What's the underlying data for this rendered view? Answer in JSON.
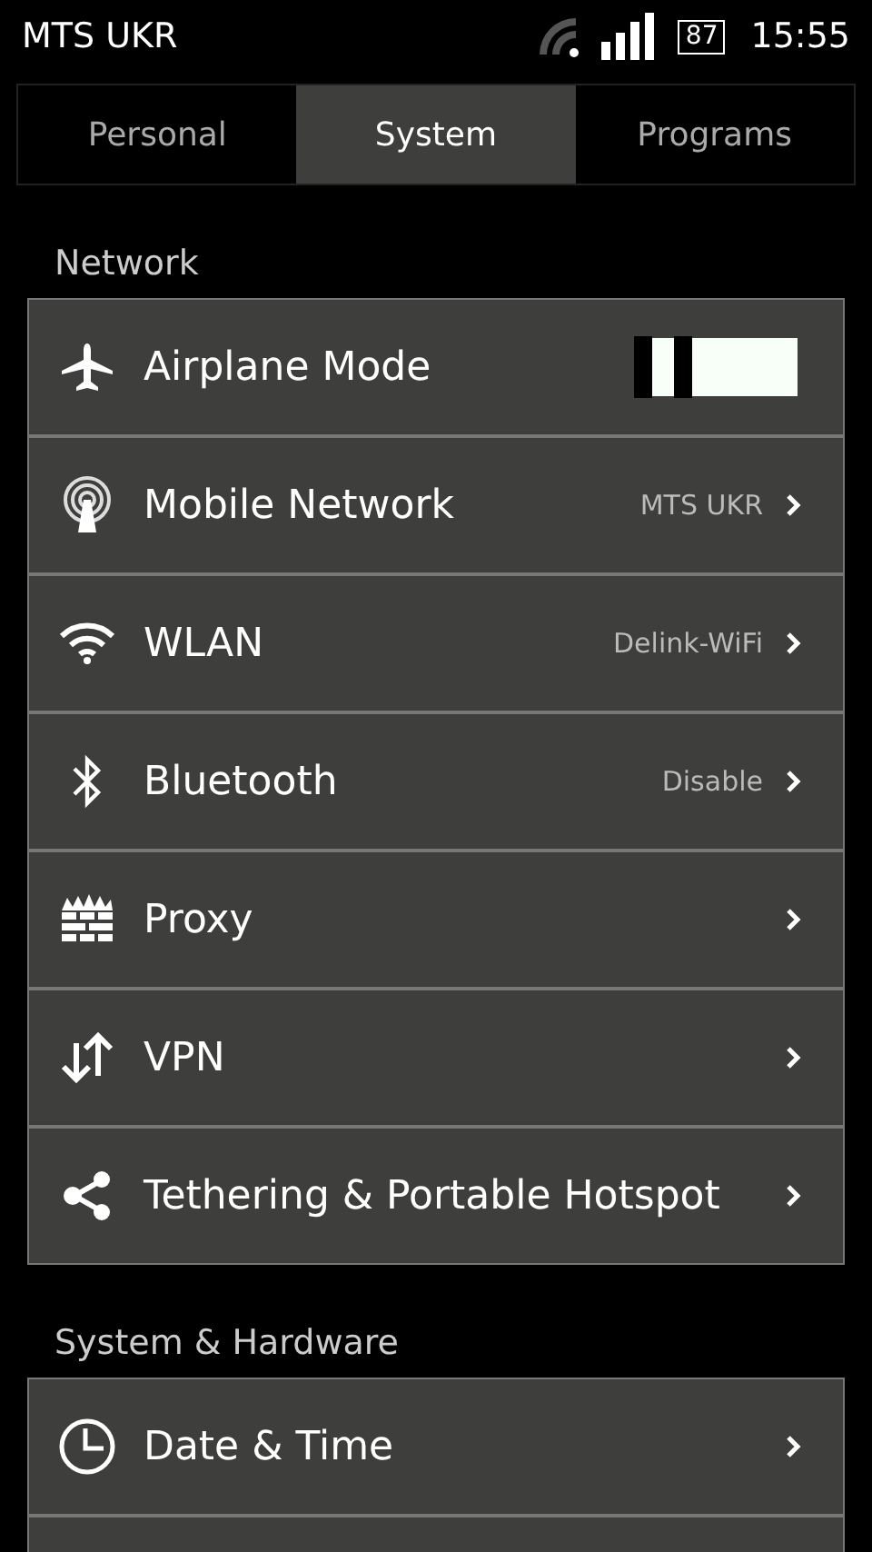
{
  "status_bar": {
    "carrier": "MTS UKR",
    "battery": "87",
    "time": "15:55"
  },
  "tabs": [
    {
      "label": "Personal",
      "selected": false
    },
    {
      "label": "System",
      "selected": true
    },
    {
      "label": "Programs",
      "selected": false
    }
  ],
  "sections": [
    {
      "title": "Network",
      "items": [
        {
          "label": "Airplane Mode",
          "kind": "toggle",
          "on": false
        },
        {
          "label": "Mobile Network",
          "kind": "link",
          "value": "MTS UKR"
        },
        {
          "label": "WLAN",
          "kind": "link",
          "value": "Delink-WiFi"
        },
        {
          "label": "Bluetooth",
          "kind": "link",
          "value": "Disable"
        },
        {
          "label": "Proxy",
          "kind": "link"
        },
        {
          "label": "VPN",
          "kind": "link"
        },
        {
          "label": "Tethering & Portable Hotspot",
          "kind": "link"
        }
      ]
    },
    {
      "title": "System & Hardware",
      "items": [
        {
          "label": "Date & Time",
          "kind": "link"
        },
        {
          "kind": "blank"
        }
      ]
    }
  ]
}
